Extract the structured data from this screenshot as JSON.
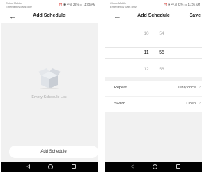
{
  "screens": {
    "list": {
      "status": {
        "carrier_line1": "China Mobile",
        "carrier_line2": "Emergency calls only",
        "right": "⏰ ✱ ⁴ᴳ.ıll 22% ▭ 11:05 AM"
      },
      "nav": {
        "title": "Add Schedule",
        "back_icon": "arrow-left-icon"
      },
      "empty_state": {
        "icon": "empty-box-icon",
        "label": "Empty Schedule List"
      },
      "add_button_label": "Add Schedule"
    },
    "edit": {
      "status": {
        "carrier_line1": "China Mobile",
        "carrier_line2": "Emergency calls only",
        "right": "⏰ ✱ ⁴ᴳ.ıll 22% ▭ 11:05 AM"
      },
      "nav": {
        "title": "Add Schedule",
        "save_label": "Save",
        "back_icon": "arrow-left-icon"
      },
      "picker": {
        "prev": {
          "hour": "10",
          "minute": "54"
        },
        "selected": {
          "hour": "11",
          "minute": "55"
        },
        "next": {
          "hour": "12",
          "minute": "56"
        }
      },
      "settings": [
        {
          "label": "Repeat",
          "value": "Only once"
        },
        {
          "label": "Switch",
          "value": "Open"
        }
      ]
    }
  },
  "system_nav": {
    "back_icon": "triangle-back-icon",
    "home_icon": "circle-home-icon",
    "recent_icon": "square-recent-icon"
  }
}
